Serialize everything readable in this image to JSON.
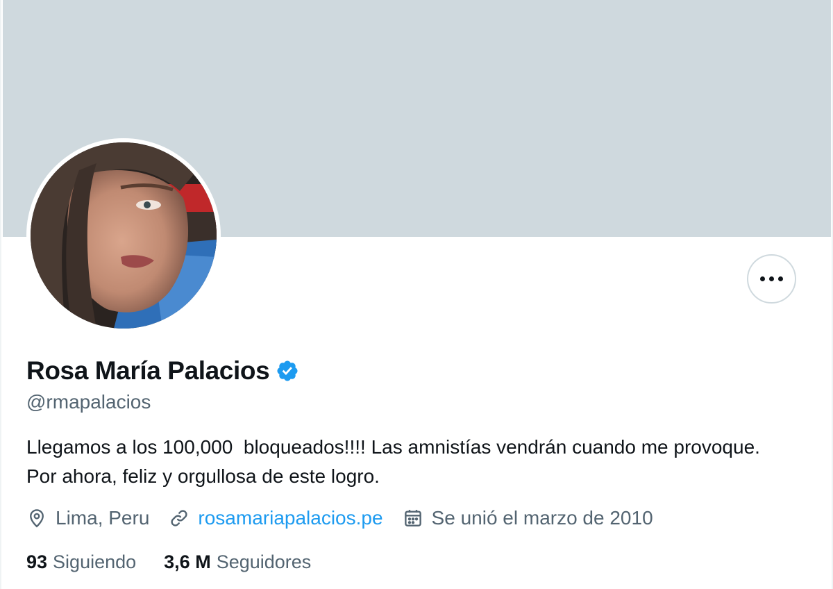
{
  "profile": {
    "display_name": "Rosa María Palacios",
    "handle": "@rmapalacios",
    "bio": "Llegamos a los 100,000  bloqueados!!!! Las amnistías vendrán cuando me provoque. Por ahora, feliz y orgullosa de este logro.",
    "verified": true
  },
  "meta": {
    "location": "Lima, Peru",
    "website": "rosamariapalacios.pe",
    "joined": "Se unió el marzo de 2010"
  },
  "stats": {
    "following_count": "93",
    "following_label": "Siguiendo",
    "followers_count": "3,6 M",
    "followers_label": "Seguidores"
  },
  "icons": {
    "verified": "verified-badge-icon",
    "location": "location-pin-icon",
    "website": "link-icon",
    "joined": "calendar-icon",
    "more": "more-options-icon"
  },
  "colors": {
    "banner": "#cfd9de",
    "accent": "#1d9bf0",
    "secondary_text": "#536471",
    "primary_text": "#0f1419"
  }
}
